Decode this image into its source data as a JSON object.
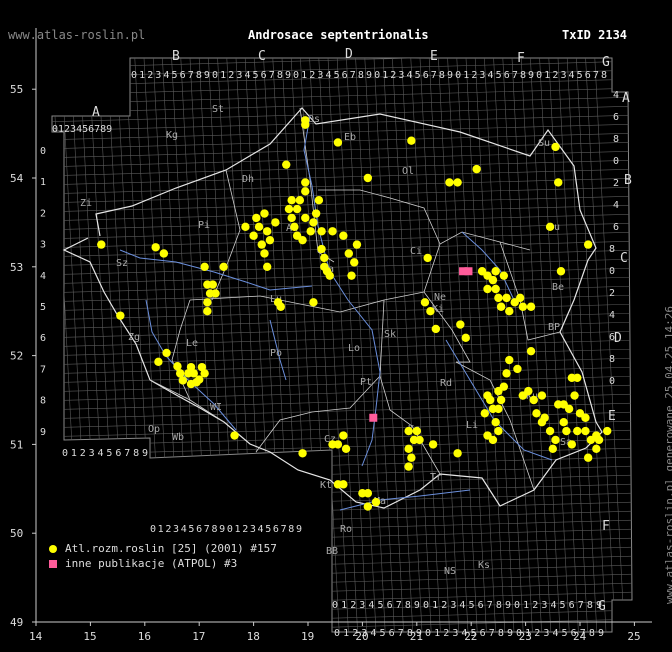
{
  "header": {
    "site": "www.atlas-roslin.pl",
    "title": "Androsace septentrionalis",
    "txid": "TxID 2134"
  },
  "generated": "www.atlas-roslin.pl generowane 25.04.25 14:26",
  "legend": [
    {
      "label": "Atl.rozm.roslin [25] (2001) #157",
      "marker": "circle"
    },
    {
      "label": "inne publikacje (ATPOL) #3",
      "marker": "square"
    }
  ],
  "axes": {
    "x_ticks": [
      "14",
      "15",
      "16",
      "17",
      "18",
      "19",
      "20",
      "21",
      "22",
      "23",
      "24",
      "25"
    ],
    "y_ticks": [
      "55",
      "54",
      "53",
      "52",
      "51",
      "50",
      "49"
    ]
  },
  "atpol": {
    "columns": [
      "A",
      "B",
      "C",
      "D",
      "E",
      "F",
      "G"
    ],
    "rows": [
      "A",
      "B",
      "C",
      "D",
      "E",
      "F",
      "G"
    ],
    "digits": "0123456789"
  },
  "regions": [
    "St",
    "Kg",
    "Eb",
    "Ol",
    "Su",
    "Dh",
    "Pi",
    "Bu",
    "Ci",
    "Au",
    "Wa",
    "Ki",
    "Sk",
    "BP",
    "Zg",
    "Le",
    "Po",
    "Lo",
    "Pt",
    "Rd",
    "Ku",
    "WI",
    "Kc",
    "Wb",
    "Op",
    "Cz",
    "Sa",
    "Ma",
    "Tr",
    "NS",
    "Ks",
    "BB",
    "Kt",
    "Ro",
    "Li",
    "Zi",
    "Sz",
    "Os",
    "Ne",
    "Lu",
    "Be"
  ],
  "colors": {
    "main": "#ffff00",
    "other": "#ff5c9a",
    "grid": "#5a5a5a",
    "border": "#e6e6e6",
    "rivers": "#6b8fdc"
  },
  "chart_data": {
    "type": "scatter",
    "xlim": [
      14,
      25
    ],
    "ylim": [
      49,
      55.4
    ],
    "series": [
      {
        "name": "Atl.rozm.roslin [25] (2001) #157",
        "marker": "circle",
        "color": "#ffff00",
        "points": [
          [
            15.2,
            53.25
          ],
          [
            15.55,
            52.45
          ],
          [
            16.2,
            53.22
          ],
          [
            16.35,
            53.15
          ],
          [
            16.25,
            51.93
          ],
          [
            16.4,
            52.03
          ],
          [
            16.6,
            51.88
          ],
          [
            16.65,
            51.8
          ],
          [
            16.7,
            51.72
          ],
          [
            16.85,
            51.87
          ],
          [
            16.9,
            51.8
          ],
          [
            16.85,
            51.68
          ],
          [
            16.95,
            51.7
          ],
          [
            17.0,
            51.73
          ],
          [
            17.05,
            51.87
          ],
          [
            17.1,
            51.8
          ],
          [
            16.8,
            51.8
          ],
          [
            17.1,
            53.0
          ],
          [
            17.15,
            52.8
          ],
          [
            17.2,
            52.7
          ],
          [
            17.15,
            52.6
          ],
          [
            17.15,
            52.5
          ],
          [
            17.3,
            52.7
          ],
          [
            17.25,
            52.8
          ],
          [
            17.45,
            53.0
          ],
          [
            17.65,
            51.1
          ],
          [
            17.85,
            53.45
          ],
          [
            18.0,
            53.35
          ],
          [
            18.05,
            53.55
          ],
          [
            18.1,
            53.45
          ],
          [
            18.2,
            53.6
          ],
          [
            18.25,
            53.4
          ],
          [
            18.3,
            53.3
          ],
          [
            18.15,
            53.25
          ],
          [
            18.2,
            53.15
          ],
          [
            18.25,
            53.0
          ],
          [
            18.4,
            53.5
          ],
          [
            18.45,
            52.6
          ],
          [
            18.5,
            52.55
          ],
          [
            18.6,
            54.15
          ],
          [
            18.65,
            53.65
          ],
          [
            18.7,
            53.75
          ],
          [
            18.7,
            53.55
          ],
          [
            18.75,
            53.45
          ],
          [
            18.8,
            53.65
          ],
          [
            18.85,
            53.75
          ],
          [
            18.8,
            53.35
          ],
          [
            18.9,
            53.3
          ],
          [
            18.95,
            53.55
          ],
          [
            18.95,
            53.85
          ],
          [
            18.95,
            53.95
          ],
          [
            19.05,
            53.4
          ],
          [
            19.1,
            53.5
          ],
          [
            19.15,
            53.6
          ],
          [
            19.2,
            53.75
          ],
          [
            19.25,
            53.4
          ],
          [
            19.25,
            53.2
          ],
          [
            19.3,
            53.1
          ],
          [
            19.35,
            52.95
          ],
          [
            19.4,
            52.9
          ],
          [
            19.3,
            53.0
          ],
          [
            19.45,
            53.4
          ],
          [
            19.1,
            52.6
          ],
          [
            18.9,
            50.9
          ],
          [
            18.95,
            54.6
          ],
          [
            18.95,
            54.65
          ],
          [
            19.55,
            54.4
          ],
          [
            19.65,
            53.35
          ],
          [
            19.75,
            53.15
          ],
          [
            19.8,
            52.9
          ],
          [
            19.85,
            53.05
          ],
          [
            19.9,
            53.25
          ],
          [
            19.45,
            51.0
          ],
          [
            19.55,
            51.0
          ],
          [
            19.65,
            51.1
          ],
          [
            19.7,
            50.95
          ],
          [
            19.55,
            50.55
          ],
          [
            19.65,
            50.55
          ],
          [
            20.0,
            50.45
          ],
          [
            20.1,
            50.45
          ],
          [
            20.1,
            50.3
          ],
          [
            20.25,
            50.35
          ],
          [
            20.1,
            54.0
          ],
          [
            20.9,
            54.42
          ],
          [
            20.85,
            51.15
          ],
          [
            20.95,
            51.05
          ],
          [
            20.85,
            50.95
          ],
          [
            20.9,
            50.85
          ],
          [
            20.85,
            50.75
          ],
          [
            21.0,
            51.15
          ],
          [
            21.05,
            51.05
          ],
          [
            21.2,
            53.1
          ],
          [
            21.3,
            51.0
          ],
          [
            21.15,
            52.6
          ],
          [
            21.25,
            52.5
          ],
          [
            21.35,
            52.3
          ],
          [
            21.6,
            53.95
          ],
          [
            21.75,
            53.95
          ],
          [
            21.75,
            50.9
          ],
          [
            21.8,
            52.35
          ],
          [
            21.9,
            52.2
          ],
          [
            22.1,
            54.1
          ],
          [
            22.2,
            52.95
          ],
          [
            22.3,
            52.9
          ],
          [
            22.4,
            52.85
          ],
          [
            22.45,
            52.75
          ],
          [
            22.5,
            52.65
          ],
          [
            22.55,
            52.55
          ],
          [
            22.3,
            52.75
          ],
          [
            22.45,
            52.95
          ],
          [
            22.6,
            52.9
          ],
          [
            22.65,
            52.65
          ],
          [
            22.7,
            52.5
          ],
          [
            22.8,
            52.6
          ],
          [
            22.9,
            52.65
          ],
          [
            22.95,
            52.55
          ],
          [
            23.1,
            52.55
          ],
          [
            23.1,
            52.05
          ],
          [
            22.7,
            51.95
          ],
          [
            22.85,
            51.85
          ],
          [
            22.65,
            51.8
          ],
          [
            22.6,
            51.65
          ],
          [
            22.55,
            51.5
          ],
          [
            22.5,
            51.4
          ],
          [
            22.45,
            51.25
          ],
          [
            22.3,
            51.1
          ],
          [
            22.25,
            51.35
          ],
          [
            22.35,
            51.5
          ],
          [
            22.3,
            51.55
          ],
          [
            22.4,
            51.4
          ],
          [
            22.4,
            51.05
          ],
          [
            22.5,
            51.15
          ],
          [
            22.5,
            51.6
          ],
          [
            22.95,
            51.55
          ],
          [
            23.05,
            51.6
          ],
          [
            23.15,
            51.5
          ],
          [
            23.2,
            51.35
          ],
          [
            23.3,
            51.25
          ],
          [
            23.45,
            51.15
          ],
          [
            23.55,
            51.05
          ],
          [
            23.6,
            51.45
          ],
          [
            23.7,
            51.45
          ],
          [
            23.8,
            51.4
          ],
          [
            23.7,
            51.25
          ],
          [
            23.75,
            51.15
          ],
          [
            23.85,
            51.0
          ],
          [
            23.95,
            51.15
          ],
          [
            24.1,
            51.15
          ],
          [
            24.2,
            51.05
          ],
          [
            24.3,
            51.1
          ],
          [
            24.5,
            51.15
          ],
          [
            24.0,
            51.35
          ],
          [
            24.1,
            51.3
          ],
          [
            24.15,
            50.85
          ],
          [
            24.3,
            50.95
          ],
          [
            24.35,
            51.05
          ],
          [
            23.5,
            50.95
          ],
          [
            23.55,
            54.35
          ],
          [
            23.6,
            53.95
          ],
          [
            23.65,
            52.95
          ],
          [
            23.45,
            53.45
          ],
          [
            24.15,
            53.25
          ],
          [
            23.85,
            51.75
          ],
          [
            23.95,
            51.75
          ],
          [
            23.9,
            51.55
          ],
          [
            23.35,
            51.3
          ],
          [
            23.3,
            51.55
          ],
          [
            22.95,
            51.55
          ]
        ]
      },
      {
        "name": "inne publikacje (ATPOL) #3",
        "marker": "square",
        "color": "#ff5c9a",
        "points": [
          [
            21.85,
            52.95
          ],
          [
            21.95,
            52.95
          ],
          [
            20.2,
            51.3
          ]
        ]
      }
    ]
  }
}
